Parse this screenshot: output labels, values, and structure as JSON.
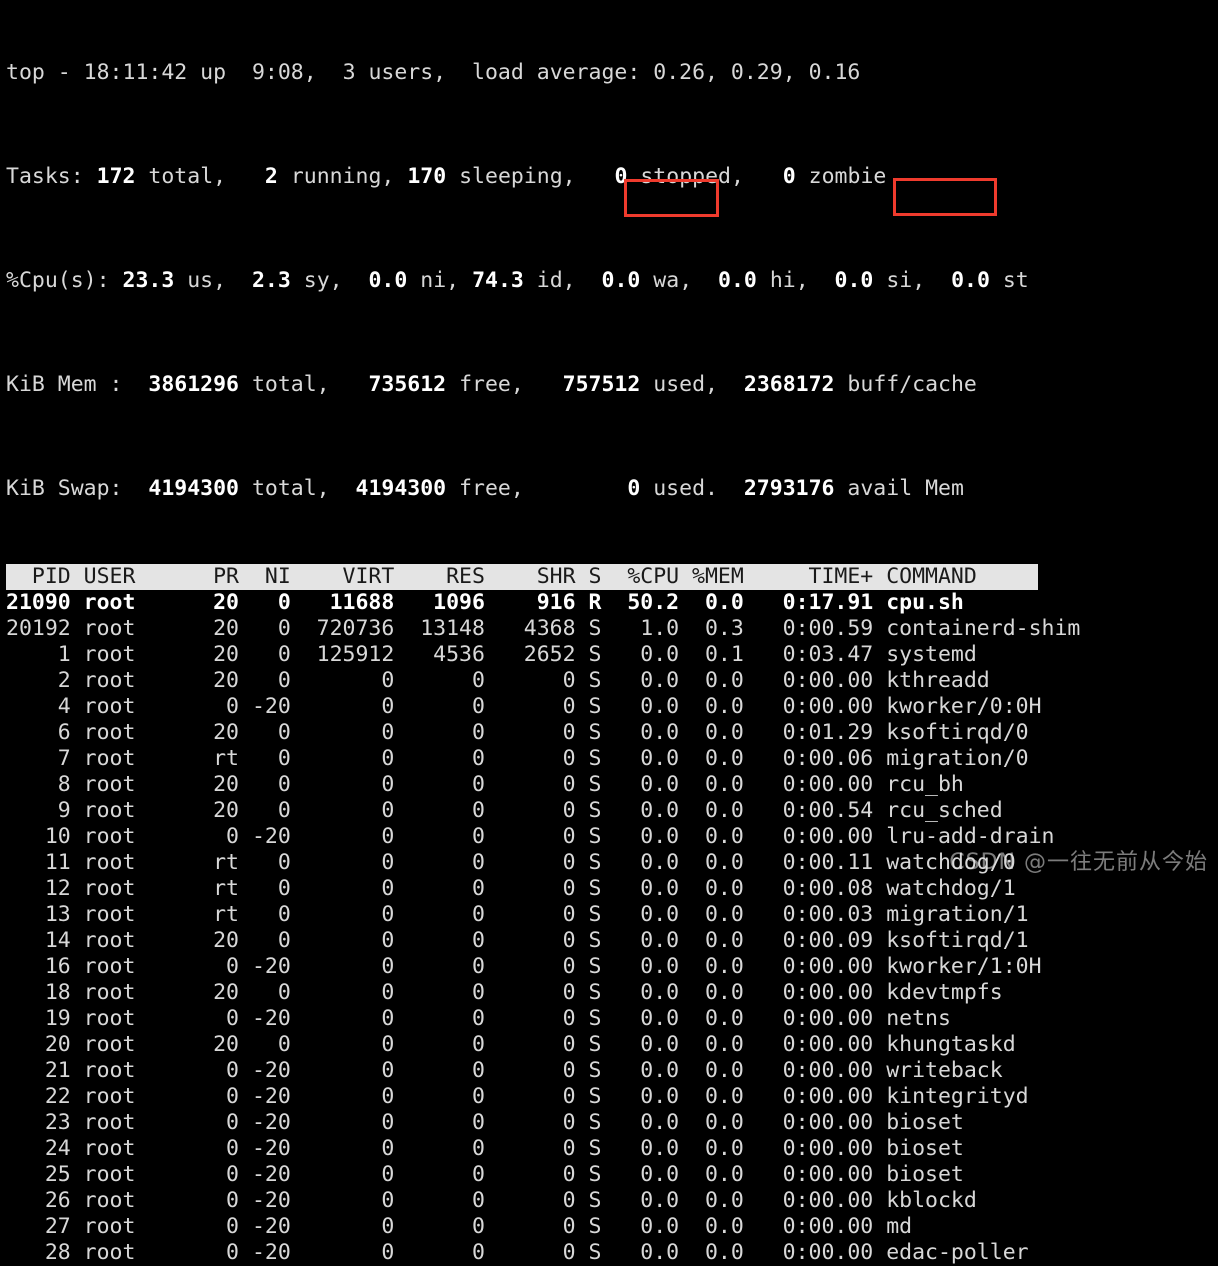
{
  "app": {
    "name": "top",
    "terminal_background": "#000000",
    "text_color": "#d8d8d8",
    "bold_color": "#ffffff",
    "header_bar_background": "#e4e4e4",
    "header_bar_text": "#1a1a1a",
    "highlight_color": "#ef3b2d"
  },
  "summary": {
    "line1": {
      "prefix": "top - ",
      "time": "18:11:42",
      "up_label": " up ",
      "uptime": " 9:08,",
      "users": "  3 users,",
      "load_label": "  load average: ",
      "load": "0.26, 0.29, 0.16",
      "full": "top - 18:11:42 up  9:08,  3 users,  load average: 0.26, 0.29, 0.16"
    },
    "line2": {
      "label": "Tasks:",
      "total": "172",
      "total_label": " total,",
      "running": "2",
      "running_label": " running,",
      "sleeping": "170",
      "sleeping_label": " sleeping,",
      "stopped": "0",
      "stopped_label": " stopped,",
      "zombie": "0",
      "zombie_label": " zombie"
    },
    "line3": {
      "label": "%Cpu(s):",
      "us": "23.3",
      "us_label": " us,",
      "sy": "2.3",
      "sy_label": " sy,",
      "ni": "0.0",
      "ni_label": " ni,",
      "id": "74.3",
      "id_label": " id,",
      "wa": "0.0",
      "wa_label": " wa,",
      "hi": "0.0",
      "hi_label": " hi,",
      "si": "0.0",
      "si_label": " si,",
      "st": "0.0",
      "st_label": " st"
    },
    "line4": {
      "label": "KiB Mem :",
      "total": "3861296",
      "total_label": " total,",
      "free": "735612",
      "free_label": " free,",
      "used": "757512",
      "used_label": " used,",
      "buffcache": "2368172",
      "buffcache_label": " buff/cache"
    },
    "line5": {
      "label": "KiB Swap:",
      "total": "4194300",
      "total_label": " total,",
      "free": "4194300",
      "free_label": " free,",
      "used": "0",
      "used_label": " used.",
      "avail": "2793176",
      "avail_label": " avail Mem"
    }
  },
  "table": {
    "columns": [
      "PID",
      "USER",
      "PR",
      "NI",
      "VIRT",
      "RES",
      "SHR",
      "S",
      "%CPU",
      "%MEM",
      "TIME+",
      "COMMAND"
    ],
    "header_line": "  PID USER      PR  NI    VIRT    RES    SHR S  %CPU %MEM     TIME+ COMMAND                  ",
    "rows": [
      {
        "pid": "21090",
        "user": "root",
        "pr": "20",
        "ni": "0",
        "virt": "11688",
        "res": "1096",
        "shr": "916",
        "s": "R",
        "cpu": "50.2",
        "mem": "0.0",
        "time": "0:17.91",
        "command": "cpu.sh"
      },
      {
        "pid": "20192",
        "user": "root",
        "pr": "20",
        "ni": "0",
        "virt": "720736",
        "res": "13148",
        "shr": "4368",
        "s": "S",
        "cpu": "1.0",
        "mem": "0.3",
        "time": "0:00.59",
        "command": "containerd-shim"
      },
      {
        "pid": "1",
        "user": "root",
        "pr": "20",
        "ni": "0",
        "virt": "125912",
        "res": "4536",
        "shr": "2652",
        "s": "S",
        "cpu": "0.0",
        "mem": "0.1",
        "time": "0:03.47",
        "command": "systemd"
      },
      {
        "pid": "2",
        "user": "root",
        "pr": "20",
        "ni": "0",
        "virt": "0",
        "res": "0",
        "shr": "0",
        "s": "S",
        "cpu": "0.0",
        "mem": "0.0",
        "time": "0:00.00",
        "command": "kthreadd"
      },
      {
        "pid": "4",
        "user": "root",
        "pr": "0",
        "ni": "-20",
        "virt": "0",
        "res": "0",
        "shr": "0",
        "s": "S",
        "cpu": "0.0",
        "mem": "0.0",
        "time": "0:00.00",
        "command": "kworker/0:0H"
      },
      {
        "pid": "6",
        "user": "root",
        "pr": "20",
        "ni": "0",
        "virt": "0",
        "res": "0",
        "shr": "0",
        "s": "S",
        "cpu": "0.0",
        "mem": "0.0",
        "time": "0:01.29",
        "command": "ksoftirqd/0"
      },
      {
        "pid": "7",
        "user": "root",
        "pr": "rt",
        "ni": "0",
        "virt": "0",
        "res": "0",
        "shr": "0",
        "s": "S",
        "cpu": "0.0",
        "mem": "0.0",
        "time": "0:00.06",
        "command": "migration/0"
      },
      {
        "pid": "8",
        "user": "root",
        "pr": "20",
        "ni": "0",
        "virt": "0",
        "res": "0",
        "shr": "0",
        "s": "S",
        "cpu": "0.0",
        "mem": "0.0",
        "time": "0:00.00",
        "command": "rcu_bh"
      },
      {
        "pid": "9",
        "user": "root",
        "pr": "20",
        "ni": "0",
        "virt": "0",
        "res": "0",
        "shr": "0",
        "s": "S",
        "cpu": "0.0",
        "mem": "0.0",
        "time": "0:00.54",
        "command": "rcu_sched"
      },
      {
        "pid": "10",
        "user": "root",
        "pr": "0",
        "ni": "-20",
        "virt": "0",
        "res": "0",
        "shr": "0",
        "s": "S",
        "cpu": "0.0",
        "mem": "0.0",
        "time": "0:00.00",
        "command": "lru-add-drain"
      },
      {
        "pid": "11",
        "user": "root",
        "pr": "rt",
        "ni": "0",
        "virt": "0",
        "res": "0",
        "shr": "0",
        "s": "S",
        "cpu": "0.0",
        "mem": "0.0",
        "time": "0:00.11",
        "command": "watchdog/0"
      },
      {
        "pid": "12",
        "user": "root",
        "pr": "rt",
        "ni": "0",
        "virt": "0",
        "res": "0",
        "shr": "0",
        "s": "S",
        "cpu": "0.0",
        "mem": "0.0",
        "time": "0:00.08",
        "command": "watchdog/1"
      },
      {
        "pid": "13",
        "user": "root",
        "pr": "rt",
        "ni": "0",
        "virt": "0",
        "res": "0",
        "shr": "0",
        "s": "S",
        "cpu": "0.0",
        "mem": "0.0",
        "time": "0:00.03",
        "command": "migration/1"
      },
      {
        "pid": "14",
        "user": "root",
        "pr": "20",
        "ni": "0",
        "virt": "0",
        "res": "0",
        "shr": "0",
        "s": "S",
        "cpu": "0.0",
        "mem": "0.0",
        "time": "0:00.09",
        "command": "ksoftirqd/1"
      },
      {
        "pid": "16",
        "user": "root",
        "pr": "0",
        "ni": "-20",
        "virt": "0",
        "res": "0",
        "shr": "0",
        "s": "S",
        "cpu": "0.0",
        "mem": "0.0",
        "time": "0:00.00",
        "command": "kworker/1:0H"
      },
      {
        "pid": "18",
        "user": "root",
        "pr": "20",
        "ni": "0",
        "virt": "0",
        "res": "0",
        "shr": "0",
        "s": "S",
        "cpu": "0.0",
        "mem": "0.0",
        "time": "0:00.00",
        "command": "kdevtmpfs"
      },
      {
        "pid": "19",
        "user": "root",
        "pr": "0",
        "ni": "-20",
        "virt": "0",
        "res": "0",
        "shr": "0",
        "s": "S",
        "cpu": "0.0",
        "mem": "0.0",
        "time": "0:00.00",
        "command": "netns"
      },
      {
        "pid": "20",
        "user": "root",
        "pr": "20",
        "ni": "0",
        "virt": "0",
        "res": "0",
        "shr": "0",
        "s": "S",
        "cpu": "0.0",
        "mem": "0.0",
        "time": "0:00.00",
        "command": "khungtaskd"
      },
      {
        "pid": "21",
        "user": "root",
        "pr": "0",
        "ni": "-20",
        "virt": "0",
        "res": "0",
        "shr": "0",
        "s": "S",
        "cpu": "0.0",
        "mem": "0.0",
        "time": "0:00.00",
        "command": "writeback"
      },
      {
        "pid": "22",
        "user": "root",
        "pr": "0",
        "ni": "-20",
        "virt": "0",
        "res": "0",
        "shr": "0",
        "s": "S",
        "cpu": "0.0",
        "mem": "0.0",
        "time": "0:00.00",
        "command": "kintegrityd"
      },
      {
        "pid": "23",
        "user": "root",
        "pr": "0",
        "ni": "-20",
        "virt": "0",
        "res": "0",
        "shr": "0",
        "s": "S",
        "cpu": "0.0",
        "mem": "0.0",
        "time": "0:00.00",
        "command": "bioset"
      },
      {
        "pid": "24",
        "user": "root",
        "pr": "0",
        "ni": "-20",
        "virt": "0",
        "res": "0",
        "shr": "0",
        "s": "S",
        "cpu": "0.0",
        "mem": "0.0",
        "time": "0:00.00",
        "command": "bioset"
      },
      {
        "pid": "25",
        "user": "root",
        "pr": "0",
        "ni": "-20",
        "virt": "0",
        "res": "0",
        "shr": "0",
        "s": "S",
        "cpu": "0.0",
        "mem": "0.0",
        "time": "0:00.00",
        "command": "bioset"
      },
      {
        "pid": "26",
        "user": "root",
        "pr": "0",
        "ni": "-20",
        "virt": "0",
        "res": "0",
        "shr": "0",
        "s": "S",
        "cpu": "0.0",
        "mem": "0.0",
        "time": "0:00.00",
        "command": "kblockd"
      },
      {
        "pid": "27",
        "user": "root",
        "pr": "0",
        "ni": "-20",
        "virt": "0",
        "res": "0",
        "shr": "0",
        "s": "S",
        "cpu": "0.0",
        "mem": "0.0",
        "time": "0:00.00",
        "command": "md"
      },
      {
        "pid": "28",
        "user": "root",
        "pr": "0",
        "ni": "-20",
        "virt": "0",
        "res": "0",
        "shr": "0",
        "s": "S",
        "cpu": "0.0",
        "mem": "0.0",
        "time": "0:00.00",
        "command": "edac-poller"
      }
    ]
  },
  "annotations": [
    {
      "name": "cpu-value-highlight",
      "target": "50.2"
    },
    {
      "name": "command-value-highlight",
      "target": "cpu.sh"
    }
  ],
  "watermark": {
    "text": "CSDN @一往无前从今始"
  }
}
